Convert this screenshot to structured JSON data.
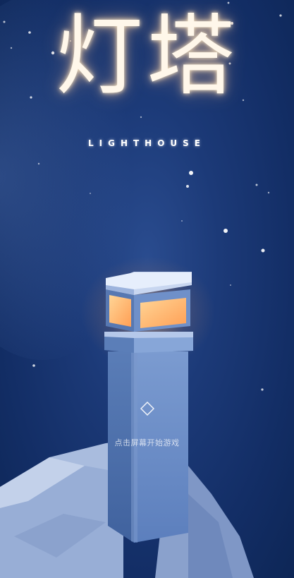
{
  "title": {
    "cjk": "灯塔",
    "english": "LIGHTHOUSE"
  },
  "start": {
    "hint": "点击屏幕开始游戏",
    "icon": "diamond-outline-icon"
  },
  "colors": {
    "sky_center": "#2a4c8f",
    "sky_edge": "#0d2656",
    "tower_front": "#6b8ec3",
    "tower_side": "#4f73ad",
    "lamp_glow": "#ffb36a",
    "ground": "#a7badc"
  }
}
